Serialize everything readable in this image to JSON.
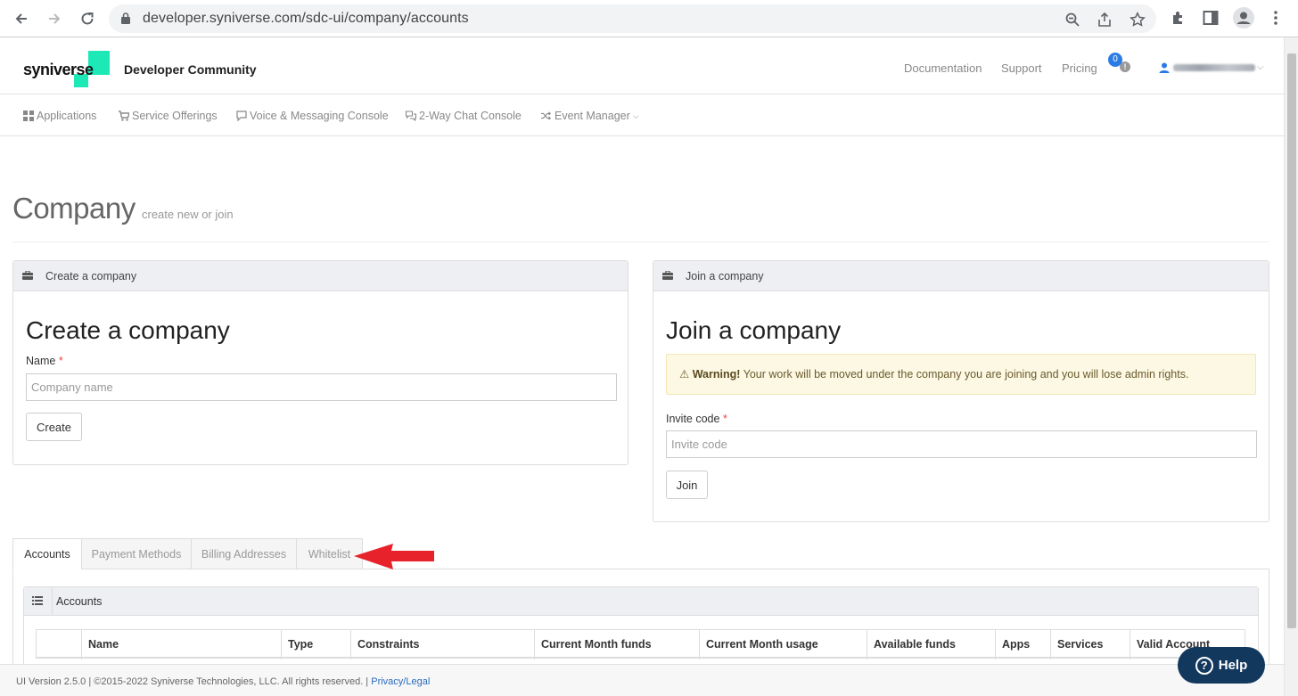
{
  "browser": {
    "url": "developer.syniverse.com/sdc-ui/company/accounts"
  },
  "header": {
    "logo": "syniverse",
    "brand_title": "Developer Community",
    "links": [
      "Documentation",
      "Support",
      "Pricing"
    ],
    "notification_count": "0",
    "notification_icon": "!"
  },
  "subnav": {
    "items": [
      {
        "label": "Applications",
        "icon": "grid-icon"
      },
      {
        "label": "Service Offerings",
        "icon": "cart-icon"
      },
      {
        "label": "Voice & Messaging Console",
        "icon": "message-icon"
      },
      {
        "label": "2-Way Chat Console",
        "icon": "chat-icon"
      },
      {
        "label": "Event Manager",
        "icon": "shuffle-icon"
      }
    ]
  },
  "page": {
    "title": "Company",
    "subtitle": "create new or join"
  },
  "create_panel": {
    "header": "Create a company",
    "heading": "Create a company",
    "name_label": "Name",
    "required_mark": "*",
    "name_placeholder": "Company name",
    "button": "Create"
  },
  "join_panel": {
    "header": "Join a company",
    "heading": "Join a company",
    "warning_bold": "Warning!",
    "warning_text": " Your work will be moved under the company you are joining and you will lose admin rights.",
    "invite_label": "Invite code",
    "required_mark": "*",
    "invite_placeholder": "Invite code",
    "button": "Join"
  },
  "tabs": [
    "Accounts",
    "Payment Methods",
    "Billing Addresses",
    "Whitelist"
  ],
  "accounts": {
    "header": "Accounts",
    "columns": [
      "",
      "Name",
      "Type",
      "Constraints",
      "Current Month funds",
      "Current Month usage",
      "Available funds",
      "Apps",
      "Services",
      "Valid Account"
    ]
  },
  "footer": {
    "text": "UI Version 2.5.0 | ©2015-2022 Syniverse Technologies, LLC. All rights reserved. | ",
    "link": "Privacy/Legal"
  },
  "help": {
    "label": "Help",
    "icon_glyph": "?"
  },
  "colors": {
    "brand_accent": "#1de9b6",
    "link_blue": "#2a7be4",
    "help_button": "#13385e",
    "warning_bg": "#fcf8e3",
    "annotation_arrow": "#e8222a"
  }
}
